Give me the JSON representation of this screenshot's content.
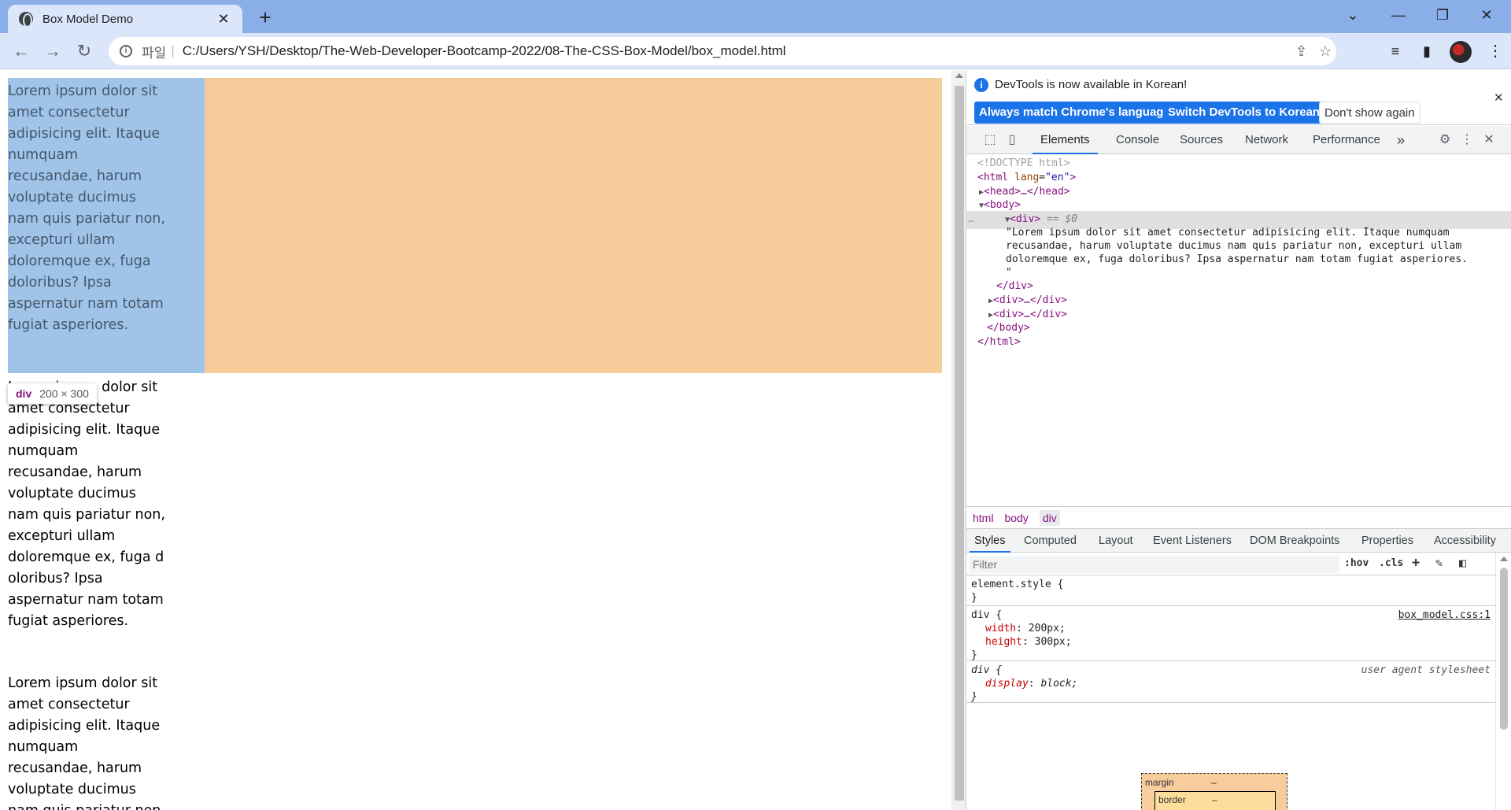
{
  "browser": {
    "tab_title": "Box Model Demo",
    "tab_close": "✕",
    "new_tab": "+",
    "window_controls": {
      "tab_search": "⌄",
      "minimize": "—",
      "restore": "❐",
      "close": "✕"
    },
    "address": {
      "scheme_label": "파일",
      "separator": "|",
      "url": "C:/Users/YSH/Desktop/The-Web-Developer-Bootcamp-2022/08-The-CSS-Box-Model/box_model.html"
    },
    "icons": {
      "back": "←",
      "forward": "→",
      "reload": "↻",
      "share": "⇪",
      "bookmark": "☆",
      "media": "≡",
      "sidebar": "▮",
      "menu": "⋮"
    }
  },
  "page": {
    "paragraph_1": "Lorem ipsum dolor sit amet consectetur adipisicing elit. Itaque numquam recusandae, harum voluptate ducimus nam quis pariatur non, excepturi ullam doloremque ex, fuga doloribus? Ipsa aspernatur nam totam fugiat asperiores.",
    "paragraph_2": "Lorem ipsum dolor sit amet consectetur adipisicing elit. Itaque numquam recusandae, harum voluptate ducimus nam quis pariatur non, excepturi ullam doloremque ex, fuga d oloribus? Ipsa aspernatur nam totam fugiat asperiores.",
    "paragraph_3": "Lorem ipsum dolor sit amet consectetur adipisicing elit. Itaque numquam recusandae, harum voluptate ducimus nam quis pariatur non, excepturi ullam",
    "tooltip": {
      "tag": "div",
      "size": "200 × 300"
    }
  },
  "devtools": {
    "notice": {
      "message": "DevTools is now available in Korean!",
      "info_icon": "i",
      "close": "✕",
      "buttons": {
        "match": "Always match Chrome's language",
        "switch": "Switch DevTools to Korean",
        "dismiss": "Don't show again"
      }
    },
    "tabs": [
      "Elements",
      "Console",
      "Sources",
      "Network",
      "Performance"
    ],
    "more_tabs": "»",
    "dom": {
      "doctype": "<!DOCTYPE html>",
      "html_open_tag": "<html",
      "html_attr_name": "lang",
      "html_attr_value": "\"en\"",
      "html_open_close": ">",
      "head": "<head>…</head>",
      "body_open": "<body>",
      "div_open": "<div>",
      "div_eq": "== $0",
      "text_1": "\"Lorem ipsum dolor sit amet consectetur adipisicing elit. Itaque numquam",
      "text_2": "recusandae, harum voluptate ducimus nam quis pariatur non, excepturi ullam",
      "text_3": "doloremque ex, fuga doloribus? Ipsa aspernatur nam totam fugiat asperiores.",
      "text_4": "\"",
      "div_close": "</div>",
      "div_collapsed": "<div>…</div>",
      "body_close": "</body>",
      "html_close": "</html>",
      "dots": "…"
    },
    "breadcrumbs": [
      "html",
      "body",
      "div"
    ],
    "style_tabs": [
      "Styles",
      "Computed",
      "Layout",
      "Event Listeners",
      "DOM Breakpoints",
      "Properties",
      "Accessibility"
    ],
    "filter": {
      "placeholder": "Filter",
      "hov": ":hov",
      "cls": ".cls",
      "add": "+"
    },
    "rules": {
      "element_style": {
        "selector": "element.style {",
        "close": "}"
      },
      "div_rule": {
        "selector": "div {",
        "source": "box_model.css:1",
        "width_prop": "width",
        "width_val": "200px;",
        "height_prop": "height",
        "height_val": "300px;",
        "close": "}"
      },
      "ua_rule": {
        "selector": "div {",
        "source": "user agent stylesheet",
        "display_prop": "display",
        "display_val": "block;",
        "close": "}"
      }
    },
    "box_model": {
      "margin_label": "margin",
      "margin_value": "–",
      "border_label": "border",
      "border_value": "–"
    }
  }
}
